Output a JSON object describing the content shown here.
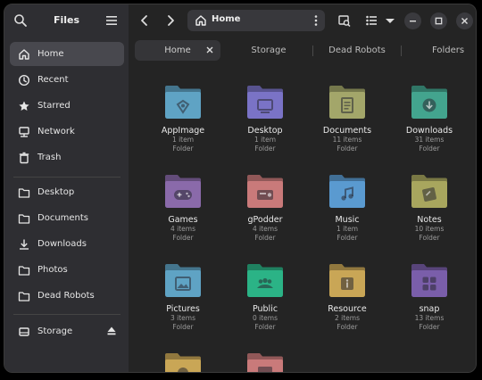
{
  "sidebar": {
    "title": "Files",
    "places": [
      {
        "label": "Home",
        "icon": "home-icon",
        "active": true
      },
      {
        "label": "Recent",
        "icon": "clock-icon"
      },
      {
        "label": "Starred",
        "icon": "star-icon"
      },
      {
        "label": "Network",
        "icon": "network-icon"
      },
      {
        "label": "Trash",
        "icon": "trash-icon"
      }
    ],
    "bookmarks": [
      {
        "label": "Desktop",
        "icon": "folder-icon"
      },
      {
        "label": "Documents",
        "icon": "folder-icon"
      },
      {
        "label": "Downloads",
        "icon": "download-icon"
      },
      {
        "label": "Photos",
        "icon": "folder-icon"
      },
      {
        "label": "Dead Robots",
        "icon": "folder-icon"
      }
    ],
    "devices": [
      {
        "label": "Storage",
        "icon": "drive-icon"
      }
    ]
  },
  "toolbar": {
    "path": "Home"
  },
  "tabs": [
    "Home",
    "Storage",
    "Dead Robots",
    "Folders"
  ],
  "items": [
    {
      "name": "AppImage",
      "count": "1 item",
      "kind": "Folder",
      "color": "#5fa3c4",
      "icon": "appimage-icon"
    },
    {
      "name": "Desktop",
      "count": "1 item",
      "kind": "Folder",
      "color": "#7a73c6",
      "icon": "desktop-icon"
    },
    {
      "name": "Documents",
      "count": "11 items",
      "kind": "Folder",
      "color": "#a3a66a",
      "icon": "document-icon"
    },
    {
      "name": "Downloads",
      "count": "31 items",
      "kind": "Folder",
      "color": "#43a48e",
      "icon": "download-icon"
    },
    {
      "name": "Games",
      "count": "4 items",
      "kind": "Folder",
      "color": "#8a6aaa",
      "icon": "gamepad-icon"
    },
    {
      "name": "gPodder",
      "count": "4 items",
      "kind": "Folder",
      "color": "#c97a7a",
      "icon": "radio-icon"
    },
    {
      "name": "Music",
      "count": "1 item",
      "kind": "Folder",
      "color": "#5a9ad0",
      "icon": "music-icon"
    },
    {
      "name": "Notes",
      "count": "10 items",
      "kind": "Folder",
      "color": "#a8a65e",
      "icon": "notes-icon"
    },
    {
      "name": "Pictures",
      "count": "3 items",
      "kind": "Folder",
      "color": "#5fa3c4",
      "icon": "picture-icon"
    },
    {
      "name": "Public",
      "count": "0 items",
      "kind": "Folder",
      "color": "#2bb386",
      "icon": "people-icon"
    },
    {
      "name": "Resource",
      "count": "2 items",
      "kind": "Folder",
      "color": "#c9a656",
      "icon": "info-icon"
    },
    {
      "name": "snap",
      "count": "13 items",
      "kind": "Folder",
      "color": "#7a5eaa",
      "icon": "apps-icon"
    },
    {
      "name": "",
      "count": "",
      "kind": "",
      "color": "#c9a656",
      "icon": "chart-icon"
    },
    {
      "name": "",
      "count": "",
      "kind": "",
      "color": "#c97a7a",
      "icon": "film-icon"
    }
  ]
}
